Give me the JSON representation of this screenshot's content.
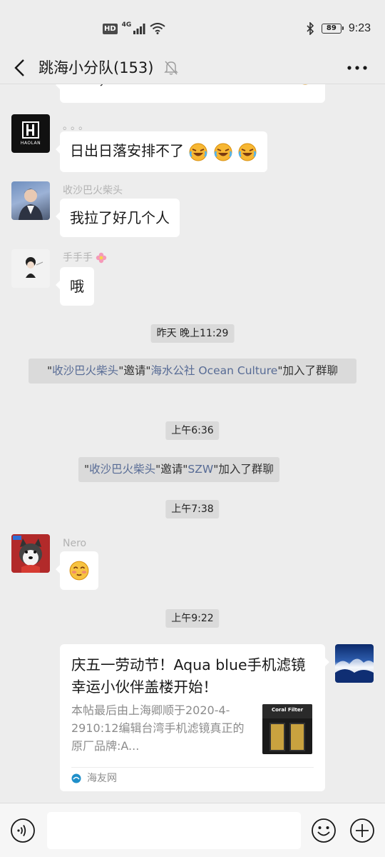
{
  "status_bar": {
    "hd": "HD",
    "network": "4G",
    "battery": "89",
    "time": "9:23"
  },
  "header": {
    "title": "跳海小分队(153)"
  },
  "messages": {
    "partial_top": "……，……",
    "msg1": {
      "avatar_text": "HAOLAN",
      "sender": "。。。",
      "text": "日出日落安排不了"
    },
    "msg2": {
      "sender": "收沙巴火柴头",
      "text": "我拉了好几个人"
    },
    "msg3": {
      "sender": "手手手",
      "text": "哦"
    },
    "time1": "昨天 晚上11:29",
    "sys1": {
      "q1": "\"",
      "inviter": "收沙巴火柴头",
      "mid": "\"邀请\"",
      "invitee": "海水公社 Ocean Culture",
      "end": "\"加入了群聊"
    },
    "time2": "上午6:36",
    "sys2": {
      "q1": "\"",
      "inviter": "收沙巴火柴头",
      "mid": "\"邀请\"",
      "invitee": "SZW",
      "end": "\"加入了群聊"
    },
    "time3": "上午7:38",
    "msg4": {
      "sender": "Nero"
    },
    "time4": "上午9:22",
    "card": {
      "title": "庆五一劳动节！Aqua blue手机滤镜幸运小伙伴盖楼开始！",
      "desc": "本帖最后由上海卿顺于2020-4-2910:12编辑台湾手机滤镜真正的原厂品牌:A...",
      "thumb_label": "Coral Filter",
      "source": "海友网"
    }
  },
  "input": {
    "placeholder": ""
  },
  "colors": {
    "background": "#ededed",
    "bubble": "#ffffff",
    "link": "#576b95",
    "time_pill": "#dadada"
  }
}
